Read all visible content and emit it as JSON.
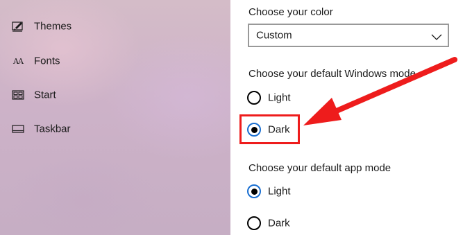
{
  "sidebar": {
    "items": [
      {
        "label": "Themes",
        "icon": "themes-icon"
      },
      {
        "label": "Fonts",
        "icon": "fonts-icon"
      },
      {
        "label": "Start",
        "icon": "start-icon"
      },
      {
        "label": "Taskbar",
        "icon": "taskbar-icon"
      }
    ],
    "fonts_icon_text": "AA"
  },
  "color": {
    "label": "Choose your color",
    "selected": "Custom",
    "chevron_icon": "chevron-down-icon"
  },
  "windows_mode": {
    "label": "Choose your default Windows mode",
    "options": [
      {
        "label": "Light",
        "checked": false
      },
      {
        "label": "Dark",
        "checked": true
      }
    ]
  },
  "app_mode": {
    "label": "Choose your default app mode",
    "options": [
      {
        "label": "Light",
        "checked": true
      },
      {
        "label": "Dark",
        "checked": false
      }
    ]
  },
  "colors": {
    "annotation": "#ee1c1c",
    "radio_accent": "#1a6fd1"
  }
}
